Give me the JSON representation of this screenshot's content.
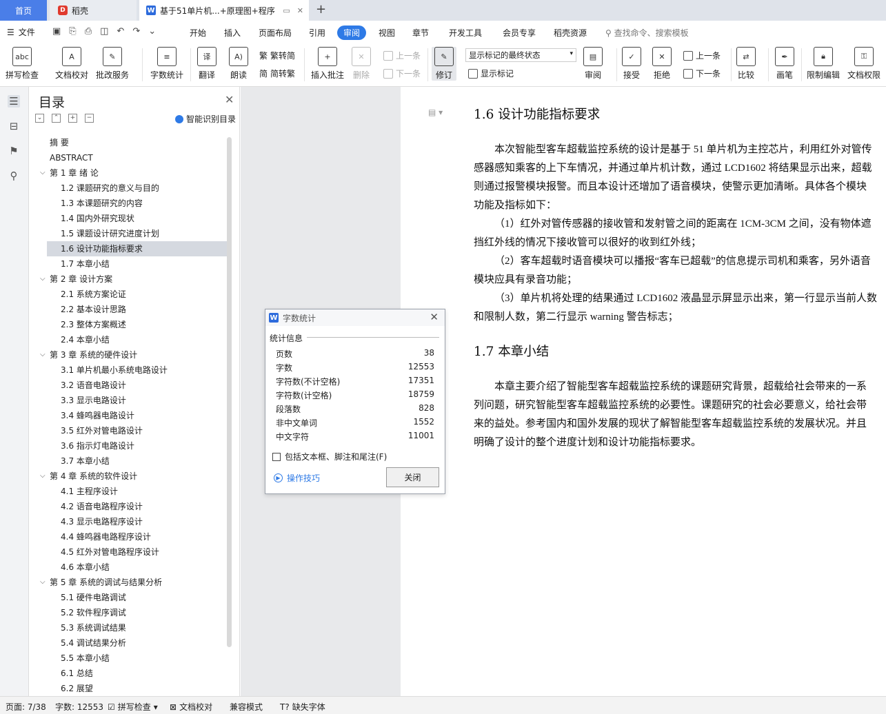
{
  "tabs": {
    "home": "首页",
    "daoke": "稻壳",
    "doc": "基于51单片机...+原理图+程序",
    "plus": "+"
  },
  "menu": {
    "file": "文件",
    "items": [
      "开始",
      "插入",
      "页面布局",
      "引用",
      "审阅",
      "视图",
      "章节",
      "开发工具",
      "会员专享",
      "稻壳资源"
    ],
    "search": "查找命令、搜索模板"
  },
  "ribbon": {
    "spell": "拼写检查",
    "proof": "文档校对",
    "annot_service": "批改服务",
    "wordcount": "字数统计",
    "translate": "翻译",
    "read": "朗读",
    "trad": "繁转简",
    "simp": "简转繁",
    "insert_comment": "插入批注",
    "delete": "删除",
    "prev": "上一条",
    "next": "下一条",
    "revise": "修订",
    "mark_state": "显示标记的最终状态",
    "show_marks": "显示标记",
    "review": "审阅",
    "accept": "接受",
    "reject": "拒绝",
    "prev2": "上一条",
    "next2": "下一条",
    "compare": "比较",
    "pen": "画笔",
    "restrict": "限制编辑",
    "perm": "文档权限"
  },
  "toc": {
    "title": "目录",
    "smart": "智能识别目录",
    "items": [
      {
        "text": "摘    要",
        "level": 0
      },
      {
        "text": "ABSTRACT",
        "level": 0
      },
      {
        "text": "第 1 章  绪  论",
        "level": 1
      },
      {
        "text": "1.2 课题研究的意义与目的",
        "level": 2
      },
      {
        "text": "1.3 本课题研究的内容",
        "level": 2
      },
      {
        "text": "1.4 国内外研究现状",
        "level": 2
      },
      {
        "text": "1.5 课题设计研究进度计划",
        "level": 2
      },
      {
        "text": "1.6 设计功能指标要求",
        "level": 2,
        "selected": true
      },
      {
        "text": "1.7  本章小结",
        "level": 2
      },
      {
        "text": "第 2 章  设计方案",
        "level": 1
      },
      {
        "text": "2.1  系统方案论证",
        "level": 2
      },
      {
        "text": "2.2  基本设计思路",
        "level": 2
      },
      {
        "text": "2.3  整体方案概述",
        "level": 2
      },
      {
        "text": "2.4  本章小结",
        "level": 2
      },
      {
        "text": "第 3 章  系统的硬件设计",
        "level": 1
      },
      {
        "text": "3.1 单片机最小系统电路设计",
        "level": 2
      },
      {
        "text": "3.2  语音电路设计",
        "level": 2
      },
      {
        "text": "3.3  显示电路设计",
        "level": 2
      },
      {
        "text": "3.4  蜂鸣器电路设计",
        "level": 2
      },
      {
        "text": "3.5  红外对管电路设计",
        "level": 2
      },
      {
        "text": "3.6  指示灯电路设计",
        "level": 2
      },
      {
        "text": "3.7  本章小结",
        "level": 2
      },
      {
        "text": "第 4 章  系统的软件设计",
        "level": 1
      },
      {
        "text": "4.1 主程序设计",
        "level": 2
      },
      {
        "text": "4.2  语音电路程序设计",
        "level": 2
      },
      {
        "text": "4.3  显示电路程序设计",
        "level": 2
      },
      {
        "text": "4.4  蜂鸣器电路程序设计",
        "level": 2
      },
      {
        "text": "4.5  红外对管电路程序设计",
        "level": 2
      },
      {
        "text": "4.6  本章小结",
        "level": 2
      },
      {
        "text": "第 5 章  系统的调试与结果分析",
        "level": 1
      },
      {
        "text": "5.1  硬件电路调试",
        "level": 2
      },
      {
        "text": "5.2  软件程序调试",
        "level": 2
      },
      {
        "text": "5.3 系统调试结果",
        "level": 2
      },
      {
        "text": "5.4  调试结果分析",
        "level": 2
      },
      {
        "text": "5.5  本章小结",
        "level": 2
      },
      {
        "text": "6.1  总结",
        "level": 2
      },
      {
        "text": "6.2  展望",
        "level": 2
      }
    ]
  },
  "doc": {
    "h16": "1.6 设计功能指标要求",
    "p1": [
      "本次智能型客车超载监控系统的设计是基于 51 单片机为主控芯片，利用红外对管传",
      "感器感知乘客的上下车情况，并通过单片机计数，通过 LCD1602 将结果显示出来，超载",
      "则通过报警模块报警。而且本设计还增加了语音模块，使警示更加清晰。具体各个模块",
      "功能及指标如下："
    ],
    "p2": [
      "（1）红外对管传感器的接收管和发射管之间的距离在 1CM-3CM 之间，没有物体遮",
      "挡红外线的情况下接收管可以很好的收到红外线；"
    ],
    "p3": [
      "（2）客车超载时语音模块可以播报“客车已超载”的信息提示司机和乘客，另外语音",
      "模块应具有录音功能；"
    ],
    "p4": [
      "（3）单片机将处理的结果通过 LCD1602 液晶显示屏显示出来，第一行显示当前人数",
      "和限制人数，第二行显示 warning 警告标志；"
    ],
    "h17": "1.7  本章小结",
    "p5": [
      "本章主要介绍了智能型客车超载监控系统的课题研究背景，超载给社会带来的一系",
      "列问题，研究智能型客车超载监控系统的必要性。课题研究的社会必要意义，给社会带",
      "来的益处。参考国内和国外发展的现状了解智能型客车超载监控系统的发展状况。并且",
      "明确了设计的整个进度计划和设计功能指标要求。"
    ]
  },
  "dialog": {
    "title": "字数统计",
    "section": "统计信息",
    "stats": [
      {
        "label": "页数",
        "value": "38"
      },
      {
        "label": "字数",
        "value": "12553"
      },
      {
        "label": "字符数(不计空格)",
        "value": "17351"
      },
      {
        "label": "字符数(计空格)",
        "value": "18759"
      },
      {
        "label": "段落数",
        "value": "828"
      },
      {
        "label": "非中文单词",
        "value": "1552"
      },
      {
        "label": "中文字符",
        "value": "11001"
      }
    ],
    "include": "包括文本框、脚注和尾注(F)",
    "tips": "操作技巧",
    "close": "关闭"
  },
  "status": {
    "page": "页面: 7/38",
    "words": "字数: 12553",
    "spell": "拼写检查",
    "proof": "文档校对",
    "compat": "兼容模式",
    "missing_font": "缺失字体"
  }
}
